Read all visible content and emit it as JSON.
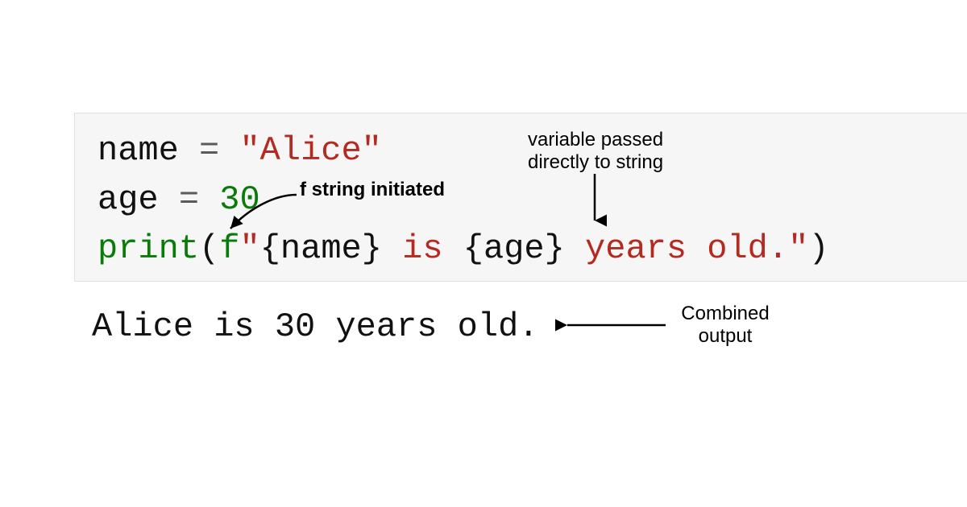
{
  "code": {
    "line1": {
      "var": "name",
      "eq": " = ",
      "str": "\"Alice\""
    },
    "line2": {
      "var": "age",
      "eq": " = ",
      "num": "30"
    },
    "line3": {
      "func": "print",
      "lp": "(",
      "f": "f",
      "q1": "\"",
      "b1o": "{",
      "v1": "name",
      "b1c": "}",
      "mid": " is ",
      "b2o": "{",
      "v2": "age",
      "b2c": "}",
      "tail": " years old.",
      "q2": "\"",
      "rp": ")"
    }
  },
  "output": "Alice is 30 years old.",
  "annotations": {
    "fstring": "f string initiated",
    "varpass_l1": "variable passed",
    "varpass_l2": "directly to string",
    "combined_l1": "Combined",
    "combined_l2": "output"
  }
}
